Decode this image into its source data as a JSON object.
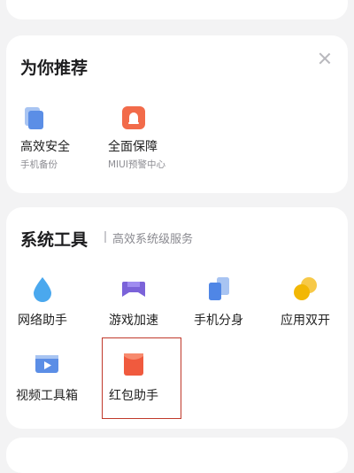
{
  "recommend": {
    "title": "为你推荐",
    "items": [
      {
        "label": "高效安全",
        "sub": "手机备份",
        "icon": "backup-icon"
      },
      {
        "label": "全面保障",
        "sub": "MIUI预警中心",
        "icon": "alert-center-icon"
      }
    ]
  },
  "tools": {
    "title": "系统工具",
    "subtitle": "高效系统级服务",
    "items": [
      {
        "label": "网络助手",
        "icon": "water-drop-icon"
      },
      {
        "label": "游戏加速",
        "icon": "gamepad-icon"
      },
      {
        "label": "手机分身",
        "icon": "phone-clone-icon"
      },
      {
        "label": "应用双开",
        "icon": "dual-app-icon"
      },
      {
        "label": "视频工具箱",
        "icon": "video-toolbox-icon"
      },
      {
        "label": "红包助手",
        "icon": "red-packet-icon"
      }
    ]
  },
  "colors": {
    "background": "#f3f3f4",
    "card": "#ffffff",
    "highlight": "#c0392b"
  }
}
